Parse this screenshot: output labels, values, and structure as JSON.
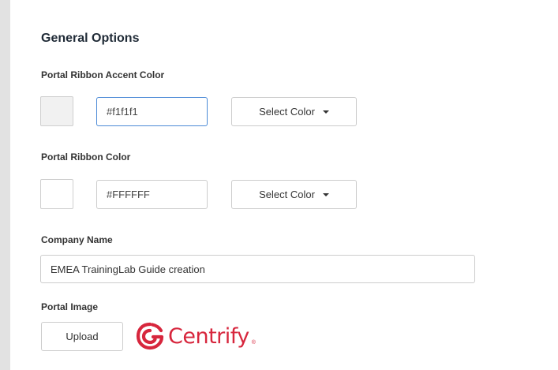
{
  "section": {
    "title": "General Options"
  },
  "accent": {
    "label": "Portal Ribbon Accent Color",
    "swatch_color": "#f1f1f1",
    "value": "#f1f1f1",
    "button_label": "Select Color"
  },
  "ribbon": {
    "label": "Portal Ribbon Color",
    "swatch_color": "#FFFFFF",
    "value": "#FFFFFF",
    "button_label": "Select Color"
  },
  "company": {
    "label": "Company Name",
    "value": "EMEA TrainingLab Guide creation"
  },
  "portal_image": {
    "label": "Portal Image",
    "upload_label": "Upload",
    "logo_text": "Centrify",
    "logo_color": "#d7263d"
  },
  "icons": {
    "caret": "chevron-down-icon",
    "logo": "centrify-logo-icon"
  }
}
